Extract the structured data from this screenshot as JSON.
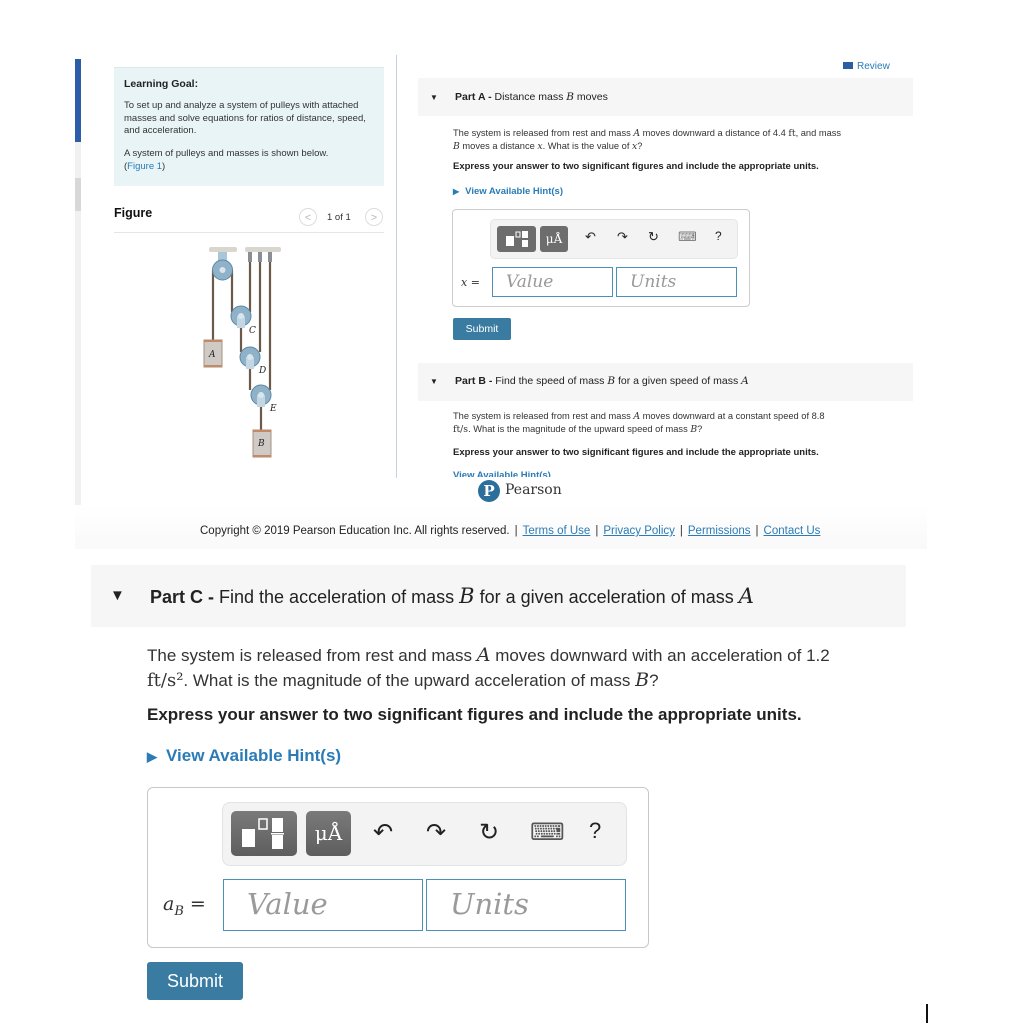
{
  "left_panel": {
    "learning_goal_title": "Learning Goal:",
    "learning_goal_text": "To set up and analyze a system of pulleys with attached masses and solve equations for ratios of distance, speed, and acceleration.",
    "system_text": "A system of pulleys and masses is shown below.",
    "figure_link_open": "(",
    "figure_link": "Figure 1",
    "figure_link_close": ")",
    "figure_title": "Figure",
    "figure_counter": "1 of 1",
    "prev_icon": "chevron-left",
    "next_icon": "chevron-right",
    "figure_labels": {
      "A": "A",
      "B": "B",
      "C": "C",
      "D": "D",
      "E": "E"
    }
  },
  "header": {
    "review_label": "Review",
    "review_icon": "book-icon"
  },
  "part_a": {
    "label": "Part A -",
    "title_pre": "Distance mass ",
    "title_var": "B",
    "title_post": " moves",
    "question_1": "The system is released from rest and mass ",
    "var_A": "A",
    "question_2": " moves downward a distance of 4.4 ",
    "unit": "ft",
    "question_3": ", and mass ",
    "var_B": "B",
    "question_4": " moves a distance ",
    "var_x": "x",
    "question_5": ". What is the value of ",
    "var_x2": "x",
    "question_6": "?",
    "instruction": "Express your answer to two significant figures and include the appropriate units.",
    "hint_label": "View Available Hint(s)",
    "answer_label": "x =",
    "value_placeholder": "Value",
    "units_placeholder": "Units",
    "submit_label": "Submit"
  },
  "part_b": {
    "label": "Part B -",
    "title_pre": "Find the speed of mass ",
    "title_var1": "B",
    "title_mid": " for a given speed of mass ",
    "title_var2": "A",
    "question_1": "The system is released from rest and mass ",
    "var_A": "A",
    "question_2": " moves downward at a constant speed of 8.8",
    "unit": "ft/s",
    "question_3": ". What is the magnitude of the upward speed of mass ",
    "var_B": "B",
    "question_4": "?",
    "instruction": "Express your answer to two significant figures and include the appropriate units.",
    "hint_label": "View Available Hint(s)"
  },
  "toolbar": {
    "templates_icon": "templates-icon",
    "symbols_label": "μÅ",
    "undo_icon": "↶",
    "redo_icon": "↷",
    "reset_icon": "↻",
    "keyboard_icon": "⌨",
    "help_label": "?"
  },
  "pearson": {
    "logo_letter": "P",
    "brand": "Pearson"
  },
  "footer": {
    "copyright": "Copyright © 2019 Pearson Education Inc. All rights reserved.",
    "links": [
      "Terms of Use",
      "Privacy Policy",
      "Permissions",
      "Contact Us"
    ],
    "separator": "|"
  },
  "part_c": {
    "label": "Part C -",
    "title_pre": " Find the acceleration of mass ",
    "title_var1": "B",
    "title_mid": " for a given acceleration of mass ",
    "title_var2": "A",
    "question_1": "The system is released from rest and mass ",
    "var_A": "A",
    "question_2": " moves downward with an acceleration of 1.2",
    "unit": "ft/s²",
    "question_3": ". What is the magnitude of the upward acceleration of mass ",
    "var_B": "B",
    "question_4": "?",
    "instruction": "Express your answer to two significant figures and include the appropriate units.",
    "hint_label": "View Available Hint(s)",
    "answer_var": "a",
    "answer_sub": "B",
    "answer_eq": " =",
    "value_placeholder": "Value",
    "units_placeholder": "Units",
    "submit_label": "Submit"
  },
  "colors": {
    "accent_blue": "#2a7bb6",
    "submit_blue": "#3a7ca1",
    "goal_bg": "#e8f4f6",
    "part_bar_bg": "#f6f6f6",
    "sidebar_blue": "#2b5ea7"
  }
}
